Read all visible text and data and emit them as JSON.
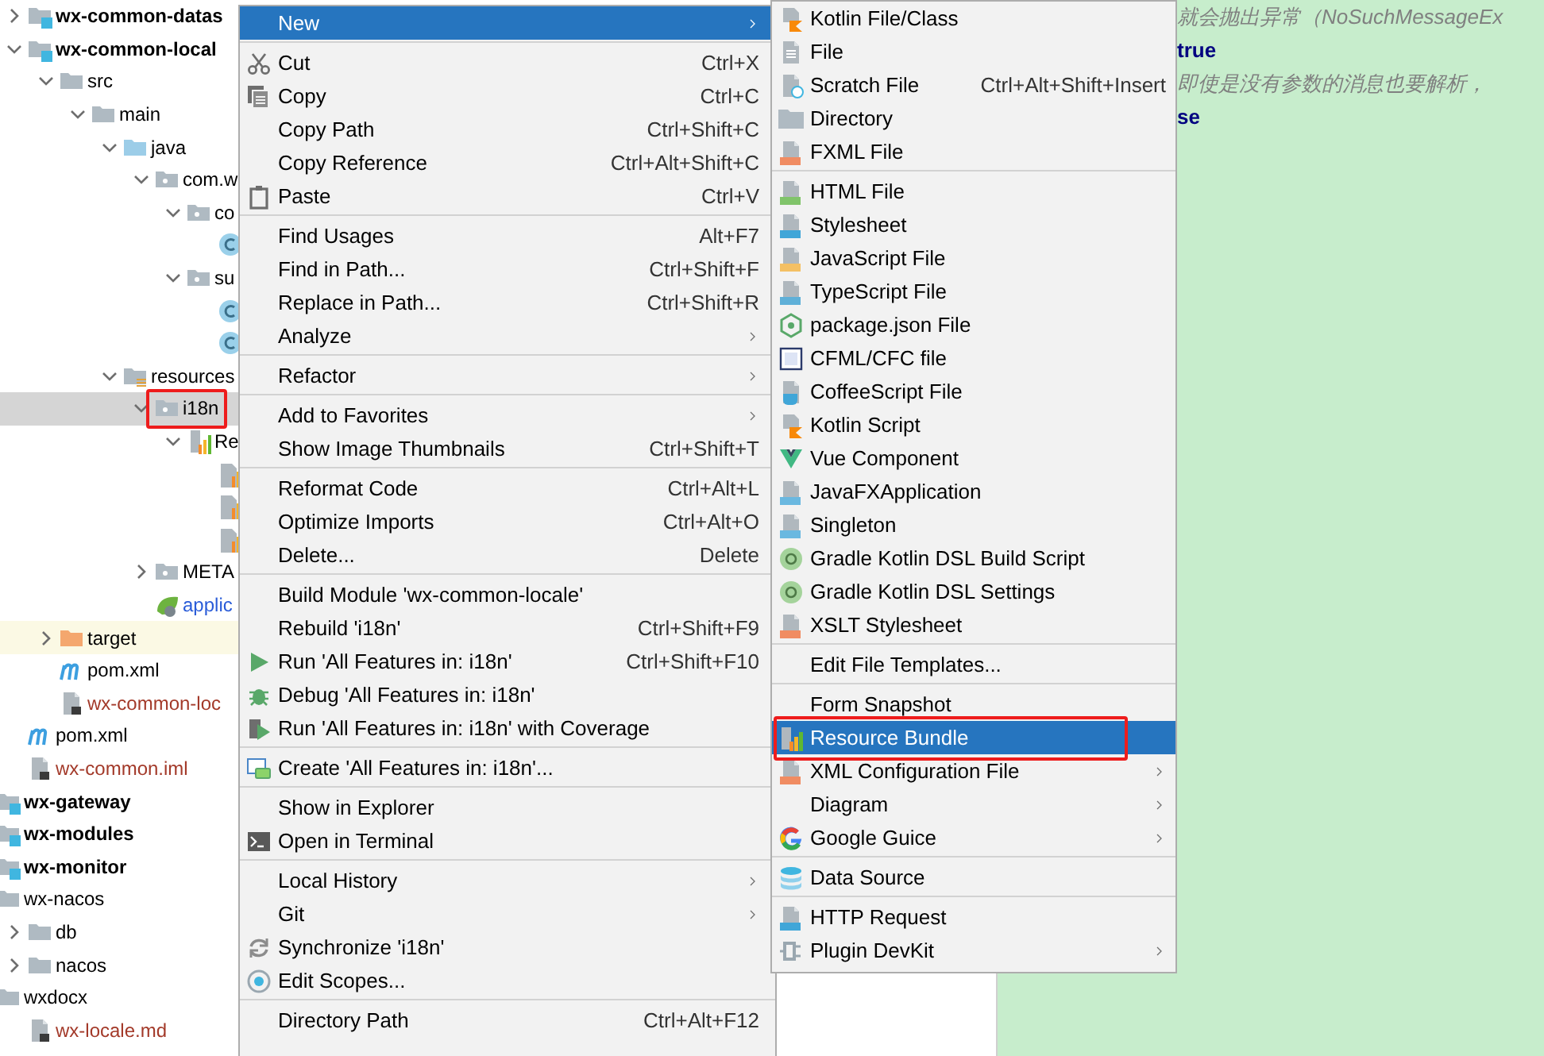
{
  "project_tree": {
    "items": [
      {
        "kind": "hidden-parent",
        "children": [
          {
            "label": "wx-common-datas",
            "kind": "module",
            "expanded": false,
            "selected": false
          },
          {
            "label": "wx-common-local",
            "kind": "module",
            "expanded": true,
            "selected": false,
            "children": [
              {
                "label": "src",
                "kind": "folder",
                "expanded": true,
                "selected": false,
                "children": [
                  {
                    "label": "main",
                    "kind": "folder",
                    "expanded": true,
                    "selected": false,
                    "children": [
                      {
                        "label": "java",
                        "kind": "source-folder",
                        "expanded": true,
                        "selected": false,
                        "children": [
                          {
                            "label": "com.w",
                            "kind": "package",
                            "expanded": true,
                            "selected": false,
                            "children": [
                              {
                                "label": "co",
                                "kind": "package",
                                "expanded": true,
                                "selected": false,
                                "children": [
                                  {
                                    "kind": "class",
                                    "selected": false
                                  }
                                ]
                              },
                              {
                                "label": "su",
                                "kind": "package",
                                "expanded": true,
                                "selected": false,
                                "children": [
                                  {
                                    "kind": "class",
                                    "selected": false
                                  },
                                  {
                                    "kind": "class",
                                    "selected": false
                                  }
                                ]
                              }
                            ]
                          }
                        ]
                      },
                      {
                        "label": "resources",
                        "kind": "resources-folder",
                        "expanded": true,
                        "selected": false,
                        "children": [
                          {
                            "label": "i18n",
                            "kind": "package",
                            "expanded": true,
                            "selected": true,
                            "marked": true,
                            "children": [
                              {
                                "label": "Re",
                                "kind": "bundle",
                                "expanded": true,
                                "selected": false,
                                "children": [
                                  {
                                    "kind": "properties",
                                    "selected": false
                                  },
                                  {
                                    "kind": "properties",
                                    "selected": false
                                  },
                                  {
                                    "kind": "properties",
                                    "selected": false
                                  }
                                ]
                              }
                            ]
                          },
                          {
                            "label": "META",
                            "kind": "package",
                            "expanded": false,
                            "selected": false
                          },
                          {
                            "label": "applic",
                            "kind": "spring-config",
                            "color": "#2a5cd8",
                            "selected": false
                          }
                        ]
                      }
                    ]
                  }
                ]
              },
              {
                "label": "target",
                "kind": "excluded-folder",
                "expanded": false,
                "selected": false
              },
              {
                "label": "pom.xml",
                "kind": "maven",
                "selected": false
              },
              {
                "label": "wx-common-loc",
                "kind": "iml",
                "color": "#a33a2a",
                "selected": false
              }
            ]
          },
          {
            "label": "pom.xml",
            "kind": "maven",
            "selected": false
          },
          {
            "label": "wx-common.iml",
            "kind": "iml",
            "color": "#a33a2a",
            "selected": false
          }
        ]
      },
      {
        "label": "wx-gateway",
        "kind": "module",
        "selected": false
      },
      {
        "label": "wx-modules",
        "kind": "module",
        "selected": false
      },
      {
        "label": "wx-monitor",
        "kind": "module",
        "selected": false
      },
      {
        "label": "wx-nacos",
        "kind": "folder",
        "selected": false,
        "children": [
          {
            "label": "db",
            "kind": "folder",
            "expanded": false,
            "selected": false
          },
          {
            "label": "nacos",
            "kind": "folder",
            "expanded": false,
            "selected": false
          }
        ]
      },
      {
        "label": "wxdocx",
        "kind": "folder",
        "selected": false,
        "children": [
          {
            "label": "wx-locale.md",
            "kind": "markdown",
            "color": "#a33a2a",
            "selected": false
          }
        ]
      }
    ]
  },
  "editor": {
    "lines": [
      {
        "text": "就会抛出异常（NoSuchMessageEx",
        "kind": "comment"
      },
      {
        "text": "true",
        "kind": "keyword"
      },
      {
        "text": "即使是没有参数的消息也要解析，",
        "kind": "comment"
      },
      {
        "text": "se",
        "kind": "keyword"
      }
    ]
  },
  "context_menu": {
    "sections": [
      {
        "items": [
          {
            "label": "New",
            "submenu": true,
            "selected": true
          }
        ]
      },
      {
        "items": [
          {
            "label": "Cut",
            "shortcut": "Ctrl+X",
            "kind": "scissors",
            "selected": false
          },
          {
            "label": "Copy",
            "shortcut": "Ctrl+C",
            "kind": "copy",
            "selected": false
          },
          {
            "label": "Copy Path",
            "shortcut": "Ctrl+Shift+C",
            "selected": false
          },
          {
            "label": "Copy Reference",
            "shortcut": "Ctrl+Alt+Shift+C",
            "selected": false
          },
          {
            "label": "Paste",
            "shortcut": "Ctrl+V",
            "kind": "clipboard",
            "selected": false
          }
        ]
      },
      {
        "items": [
          {
            "label": "Find Usages",
            "shortcut": "Alt+F7",
            "selected": false
          },
          {
            "label": "Find in Path...",
            "shortcut": "Ctrl+Shift+F",
            "selected": false
          },
          {
            "label": "Replace in Path...",
            "shortcut": "Ctrl+Shift+R",
            "selected": false
          },
          {
            "label": "Analyze",
            "submenu": true,
            "selected": false
          }
        ]
      },
      {
        "items": [
          {
            "label": "Refactor",
            "submenu": true,
            "selected": false
          }
        ]
      },
      {
        "items": [
          {
            "label": "Add to Favorites",
            "submenu": true,
            "selected": false
          },
          {
            "label": "Show Image Thumbnails",
            "shortcut": "Ctrl+Shift+T",
            "selected": false
          }
        ]
      },
      {
        "items": [
          {
            "label": "Reformat Code",
            "shortcut": "Ctrl+Alt+L",
            "selected": false
          },
          {
            "label": "Optimize Imports",
            "shortcut": "Ctrl+Alt+O",
            "selected": false
          },
          {
            "label": "Delete...",
            "shortcut": "Delete",
            "selected": false
          }
        ]
      },
      {
        "items": [
          {
            "label": "Build Module 'wx-common-locale'",
            "selected": false
          },
          {
            "label": "Rebuild 'i18n'",
            "shortcut": "Ctrl+Shift+F9",
            "selected": false
          },
          {
            "label": "Run 'All Features in: i18n'",
            "shortcut": "Ctrl+Shift+F10",
            "kind": "run",
            "selected": false
          },
          {
            "label": "Debug 'All Features in: i18n'",
            "kind": "bug",
            "selected": false
          },
          {
            "label": "Run 'All Features in: i18n' with Coverage",
            "kind": "coverage",
            "selected": false
          }
        ]
      },
      {
        "items": [
          {
            "label": "Create 'All Features in: i18n'...",
            "kind": "create",
            "selected": false
          }
        ]
      },
      {
        "items": [
          {
            "label": "Show in Explorer",
            "selected": false
          },
          {
            "label": "Open in Terminal",
            "kind": "terminal",
            "selected": false
          }
        ]
      },
      {
        "items": [
          {
            "label": "Local History",
            "submenu": true,
            "selected": false
          },
          {
            "label": "Git",
            "submenu": true,
            "selected": false
          },
          {
            "label": "Synchronize 'i18n'",
            "kind": "sync",
            "selected": false
          },
          {
            "label": "Edit Scopes...",
            "kind": "scope",
            "selected": false
          }
        ]
      },
      {
        "items": [
          {
            "label": "Directory Path",
            "shortcut": "Ctrl+Alt+F12",
            "selected": false
          }
        ]
      }
    ]
  },
  "new_submenu": {
    "sections": [
      {
        "items": [
          {
            "label": "Kotlin File/Class",
            "kind": "kotlin",
            "selected": false
          },
          {
            "label": "File",
            "kind": "file",
            "selected": false
          },
          {
            "label": "Scratch File",
            "shortcut": "Ctrl+Alt+Shift+Insert",
            "kind": "scratch",
            "selected": false
          },
          {
            "label": "Directory",
            "kind": "directory",
            "selected": false
          },
          {
            "label": "FXML File",
            "kind": "markup",
            "selected": false
          }
        ]
      },
      {
        "items": [
          {
            "label": "HTML File",
            "kind": "html",
            "selected": false
          },
          {
            "label": "Stylesheet",
            "kind": "css",
            "selected": false
          },
          {
            "label": "JavaScript File",
            "kind": "js",
            "selected": false
          },
          {
            "label": "TypeScript File",
            "kind": "ts",
            "selected": false
          },
          {
            "label": "package.json File",
            "kind": "node",
            "selected": false
          },
          {
            "label": "CFML/CFC file",
            "kind": "cfml",
            "selected": false
          },
          {
            "label": "CoffeeScript File",
            "kind": "coffee",
            "selected": false
          },
          {
            "label": "Kotlin Script",
            "kind": "kotlin",
            "selected": false
          },
          {
            "label": "Vue Component",
            "kind": "vue",
            "selected": false
          },
          {
            "label": "JavaFXApplication",
            "kind": "java",
            "selected": false
          },
          {
            "label": "Singleton",
            "kind": "java",
            "selected": false
          },
          {
            "label": "Gradle Kotlin DSL Build Script",
            "kind": "gradle",
            "selected": false
          },
          {
            "label": "Gradle Kotlin DSL Settings",
            "kind": "gradle",
            "selected": false
          },
          {
            "label": "XSLT Stylesheet",
            "kind": "markup",
            "selected": false
          }
        ]
      },
      {
        "items": [
          {
            "label": "Edit File Templates...",
            "selected": false
          }
        ]
      },
      {
        "items": [
          {
            "label": "Form Snapshot",
            "selected": false
          },
          {
            "label": "Resource Bundle",
            "kind": "bundle",
            "selected": true,
            "marked": true
          },
          {
            "label": "XML Configuration File",
            "kind": "markup",
            "submenu": true,
            "selected": false
          },
          {
            "label": "Diagram",
            "submenu": true,
            "selected": false
          },
          {
            "label": "Google Guice",
            "kind": "google",
            "submenu": true,
            "selected": false
          }
        ]
      },
      {
        "items": [
          {
            "label": "Data Source",
            "kind": "database",
            "selected": false
          }
        ]
      },
      {
        "items": [
          {
            "label": "HTTP Request",
            "kind": "api",
            "selected": false
          },
          {
            "label": "Plugin DevKit",
            "kind": "plugin",
            "submenu": true,
            "selected": false
          }
        ]
      }
    ]
  }
}
